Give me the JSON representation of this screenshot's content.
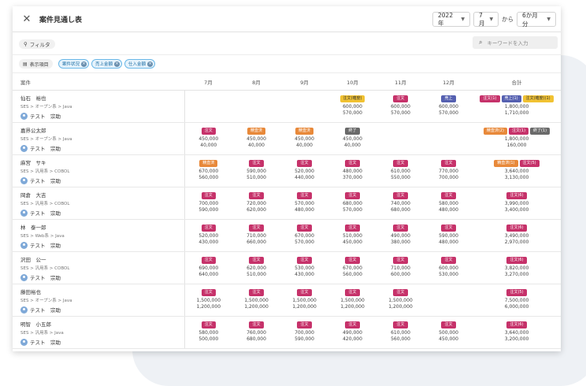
{
  "header": {
    "title": "案件見通し表",
    "year": "2022年",
    "month": "7月",
    "from_label": "から",
    "span": "6か月分"
  },
  "toolbar": {
    "filter_label": "フィルタ",
    "search_placeholder": "キーワードを入力",
    "display_label": "表示項目",
    "tags": [
      "案件状況",
      "売上金額",
      "仕入金額"
    ]
  },
  "table": {
    "headers": [
      "案件",
      "7月",
      "8月",
      "9月",
      "10月",
      "11月",
      "12月",
      "合計"
    ],
    "rows": [
      {
        "name": "仙石　裕也",
        "path": "SES > オープン系 > Java",
        "person": "テスト　宗助",
        "cells": [
          null,
          null,
          null,
          {
            "badges": [
              {
                "text": "注文(確度)",
                "type": "prop"
              }
            ],
            "nums": [
              "600,000",
              "570,000"
            ]
          },
          {
            "badges": [
              {
                "text": "注文",
                "type": "order"
              }
            ],
            "nums": [
              "600,000",
              "570,000"
            ]
          },
          {
            "badges": [
              {
                "text": "売上",
                "type": "sale"
              }
            ],
            "nums": [
              "600,000",
              "570,000"
            ]
          },
          {
            "badges": [
              {
                "text": "注文(1)",
                "type": "order"
              },
              {
                "text": "売上(1)",
                "type": "sale"
              },
              {
                "text": "注文(確度)(1)",
                "type": "prop"
              }
            ],
            "nums": [
              "1,800,000",
              "1,710,000"
            ]
          }
        ]
      },
      {
        "name": "嘉界公太郎",
        "path": "SES > オープン系 > Java",
        "person": "テスト　宗助",
        "cells": [
          {
            "badges": [
              {
                "text": "注文",
                "type": "order"
              }
            ],
            "nums": [
              "450,000",
              "40,000"
            ]
          },
          {
            "badges": [
              {
                "text": "精査済",
                "type": "nego"
              }
            ],
            "nums": [
              "450,000",
              "40,000"
            ]
          },
          {
            "badges": [
              {
                "text": "精査済",
                "type": "nego"
              }
            ],
            "nums": [
              "450,000",
              "40,000"
            ]
          },
          {
            "badges": [
              {
                "text": "終了",
                "type": "end"
              }
            ],
            "nums": [
              "450,000",
              "40,000"
            ]
          },
          null,
          null,
          {
            "badges": [
              {
                "text": "精査済(2)",
                "type": "nego"
              },
              {
                "text": "注文(1)",
                "type": "order"
              },
              {
                "text": "終了(1)",
                "type": "end"
              }
            ],
            "nums": [
              "1,800,000",
              "160,000"
            ]
          }
        ]
      },
      {
        "name": "麻宮　サキ",
        "path": "SES > 汎用系 > COBOL",
        "person": "テスト　宗助",
        "cells": [
          {
            "badges": [
              {
                "text": "精査済",
                "type": "nego"
              }
            ],
            "nums": [
              "670,000",
              "560,000"
            ]
          },
          {
            "badges": [
              {
                "text": "注文",
                "type": "order"
              }
            ],
            "nums": [
              "590,000",
              "510,000"
            ]
          },
          {
            "badges": [
              {
                "text": "注文",
                "type": "order"
              }
            ],
            "nums": [
              "520,000",
              "440,000"
            ]
          },
          {
            "badges": [
              {
                "text": "注文",
                "type": "order"
              }
            ],
            "nums": [
              "480,000",
              "370,000"
            ]
          },
          {
            "badges": [
              {
                "text": "注文",
                "type": "order"
              }
            ],
            "nums": [
              "610,000",
              "550,000"
            ]
          },
          {
            "badges": [
              {
                "text": "注文",
                "type": "order"
              }
            ],
            "nums": [
              "770,000",
              "700,000"
            ]
          },
          {
            "badges": [
              {
                "text": "精査済(1)",
                "type": "nego"
              },
              {
                "text": "注文(5)",
                "type": "order"
              }
            ],
            "nums": [
              "3,640,000",
              "3,130,000"
            ]
          }
        ]
      },
      {
        "name": "岡倉　大吉",
        "path": "SES > 汎用系 > COBOL",
        "person": "テスト　宗助",
        "cells": [
          {
            "badges": [
              {
                "text": "注文",
                "type": "order"
              }
            ],
            "nums": [
              "700,000",
              "590,000"
            ]
          },
          {
            "badges": [
              {
                "text": "注文",
                "type": "order"
              }
            ],
            "nums": [
              "720,000",
              "620,000"
            ]
          },
          {
            "badges": [
              {
                "text": "注文",
                "type": "order"
              }
            ],
            "nums": [
              "570,000",
              "480,000"
            ]
          },
          {
            "badges": [
              {
                "text": "注文",
                "type": "order"
              }
            ],
            "nums": [
              "680,000",
              "570,000"
            ]
          },
          {
            "badges": [
              {
                "text": "注文",
                "type": "order"
              }
            ],
            "nums": [
              "740,000",
              "680,000"
            ]
          },
          {
            "badges": [
              {
                "text": "注文",
                "type": "order"
              }
            ],
            "nums": [
              "580,000",
              "480,000"
            ]
          },
          {
            "badges": [
              {
                "text": "注文(6)",
                "type": "order"
              }
            ],
            "nums": [
              "3,990,000",
              "3,400,000"
            ]
          }
        ]
      },
      {
        "name": "林　泰一郎",
        "path": "SES > Web系 > Java",
        "person": "テスト　宗助",
        "cells": [
          {
            "badges": [
              {
                "text": "注文",
                "type": "order"
              }
            ],
            "nums": [
              "520,000",
              "430,000"
            ]
          },
          {
            "badges": [
              {
                "text": "注文",
                "type": "order"
              }
            ],
            "nums": [
              "710,000",
              "660,000"
            ]
          },
          {
            "badges": [
              {
                "text": "注文",
                "type": "order"
              }
            ],
            "nums": [
              "670,000",
              "570,000"
            ]
          },
          {
            "badges": [
              {
                "text": "注文",
                "type": "order"
              }
            ],
            "nums": [
              "510,000",
              "450,000"
            ]
          },
          {
            "badges": [
              {
                "text": "注文",
                "type": "order"
              }
            ],
            "nums": [
              "490,000",
              "380,000"
            ]
          },
          {
            "badges": [
              {
                "text": "注文",
                "type": "order"
              }
            ],
            "nums": [
              "590,000",
              "480,000"
            ]
          },
          {
            "badges": [
              {
                "text": "注文(6)",
                "type": "order"
              }
            ],
            "nums": [
              "3,490,000",
              "2,970,000"
            ]
          }
        ]
      },
      {
        "name": "沢田　公一",
        "path": "SES > 汎用系 > COBOL",
        "person": "テスト　宗助",
        "cells": [
          {
            "badges": [
              {
                "text": "注文",
                "type": "order"
              }
            ],
            "nums": [
              "690,000",
              "640,000"
            ]
          },
          {
            "badges": [
              {
                "text": "注文",
                "type": "order"
              }
            ],
            "nums": [
              "620,000",
              "510,000"
            ]
          },
          {
            "badges": [
              {
                "text": "注文",
                "type": "order"
              }
            ],
            "nums": [
              "530,000",
              "430,000"
            ]
          },
          {
            "badges": [
              {
                "text": "注文",
                "type": "order"
              }
            ],
            "nums": [
              "670,000",
              "560,000"
            ]
          },
          {
            "badges": [
              {
                "text": "注文",
                "type": "order"
              }
            ],
            "nums": [
              "710,000",
              "600,000"
            ]
          },
          {
            "badges": [
              {
                "text": "注文",
                "type": "order"
              }
            ],
            "nums": [
              "600,000",
              "530,000"
            ]
          },
          {
            "badges": [
              {
                "text": "注文(6)",
                "type": "order"
              }
            ],
            "nums": [
              "3,820,000",
              "3,270,000"
            ]
          }
        ]
      },
      {
        "name": "藤田裕也",
        "path": "SES > オープン系 > Java",
        "person": "テスト　宗助",
        "cells": [
          {
            "badges": [
              {
                "text": "注文",
                "type": "order"
              }
            ],
            "nums": [
              "1,500,000",
              "1,200,000"
            ]
          },
          {
            "badges": [
              {
                "text": "注文",
                "type": "order"
              }
            ],
            "nums": [
              "1,500,000",
              "1,200,000"
            ]
          },
          {
            "badges": [
              {
                "text": "注文",
                "type": "order"
              }
            ],
            "nums": [
              "1,500,000",
              "1,200,000"
            ]
          },
          {
            "badges": [
              {
                "text": "注文",
                "type": "order"
              }
            ],
            "nums": [
              "1,500,000",
              "1,200,000"
            ]
          },
          {
            "badges": [
              {
                "text": "注文",
                "type": "order"
              }
            ],
            "nums": [
              "1,500,000",
              "1,200,000"
            ]
          },
          null,
          {
            "badges": [
              {
                "text": "注文(5)",
                "type": "order"
              }
            ],
            "nums": [
              "7,500,000",
              "6,000,000"
            ]
          }
        ]
      },
      {
        "name": "明智　小五郎",
        "path": "SES > 汎用系 > Java",
        "person": "テスト　宗助",
        "cells": [
          {
            "badges": [
              {
                "text": "注文",
                "type": "order"
              }
            ],
            "nums": [
              "580,000",
              "500,000"
            ]
          },
          {
            "badges": [
              {
                "text": "注文",
                "type": "order"
              }
            ],
            "nums": [
              "760,000",
              "680,000"
            ]
          },
          {
            "badges": [
              {
                "text": "注文",
                "type": "order"
              }
            ],
            "nums": [
              "700,000",
              "590,000"
            ]
          },
          {
            "badges": [
              {
                "text": "注文",
                "type": "order"
              }
            ],
            "nums": [
              "490,000",
              "420,000"
            ]
          },
          {
            "badges": [
              {
                "text": "注文",
                "type": "order"
              }
            ],
            "nums": [
              "610,000",
              "560,000"
            ]
          },
          {
            "badges": [
              {
                "text": "注文",
                "type": "order"
              }
            ],
            "nums": [
              "500,000",
              "450,000"
            ]
          },
          {
            "badges": [
              {
                "text": "注文(6)",
                "type": "order"
              }
            ],
            "nums": [
              "3,640,000",
              "3,200,000"
            ]
          }
        ]
      }
    ]
  },
  "colors": {
    "order": "#c6326a",
    "negotiation": "#e8893a",
    "ended": "#6a6a6a",
    "proposal": "#f1c232",
    "sales": "#5560b0",
    "tag_border": "#6bb8e8"
  }
}
